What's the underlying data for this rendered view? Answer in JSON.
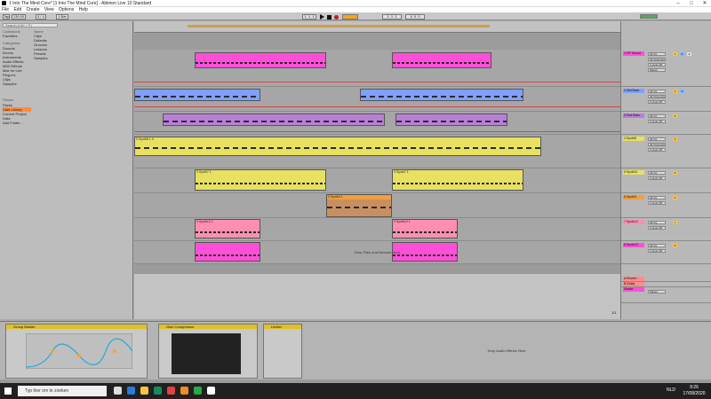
{
  "window": {
    "title": "1 Into The Mind Core* [1 Into The Mind Core] - Ableton Live 10 Standard"
  },
  "menu": [
    "File",
    "Edit",
    "Create",
    "View",
    "Options",
    "Help"
  ],
  "browser": {
    "search_placeholder": "Search (Ctrl + F)",
    "collections_label": "Collections",
    "collections": [
      "Favorites"
    ],
    "categories_label": "Categories",
    "categories": [
      "Sounds",
      "Drums",
      "Instruments",
      "Audio Effects",
      "MIDI Effects",
      "Max for Live",
      "Plug-ins",
      "Clips",
      "Samples"
    ],
    "places_label": "Places",
    "places": [
      "Packs",
      "User Library",
      "Current Project",
      "Data",
      "Add Folder..."
    ],
    "header": "Name",
    "files": [
      "Clips",
      "Defaults",
      "Grooves",
      "Lessons",
      "Presets",
      "Samples"
    ]
  },
  "arrangement": {
    "drop_text": "Drop Files and Devices Here",
    "page_indicator": "1/1"
  },
  "clips": {
    "synth_pattern": "0 Synth8 1 4",
    "synth6": "0 Synth6 1 4",
    "synth7": "0 Synth7 1",
    "synth12": "0 Synth12 1",
    "synth3": "0 Synth3 1"
  },
  "tracks": [
    {
      "name": "1 HP Sound",
      "color": "#ff4fd8",
      "num": "1"
    },
    {
      "name": "2 Mid Bass",
      "color": "#7fa0ff",
      "num": "2"
    },
    {
      "name": "3 Pad Bass",
      "color": "#b97fd6",
      "num": "3"
    },
    {
      "name": "4 Synth8",
      "color": "#e8e060",
      "num": "4"
    },
    {
      "name": "5 Synth11",
      "color": "#e8e060",
      "num": "5"
    },
    {
      "name": "6 Synth3",
      "color": "#f0a040",
      "num": "6"
    },
    {
      "name": "7 Synth12",
      "color": "#ff8fb0",
      "num": "7"
    },
    {
      "name": "8 Synth13",
      "color": "#ff4fd8",
      "num": "8"
    }
  ],
  "returns": [
    {
      "name": "A Reverb",
      "color": "#ff8c8c"
    },
    {
      "name": "B Delay",
      "color": "#ff8c8c"
    },
    {
      "name": "Master",
      "color": "#ff4fd8"
    }
  ],
  "mixer_labels": {
    "input": "All Ins",
    "channel": "All Channels",
    "monitor": "In Auto Off",
    "output": "Master"
  },
  "devices": {
    "eq": "Group Master",
    "comp": "Glue Compressor",
    "limiter": "Limiter",
    "drop_text": "Drop Audio Effects Here"
  },
  "taskbar": {
    "search_placeholder": "Typ hier om te zoeken",
    "time": "9:26",
    "date": "17/08/2020",
    "lang": "NLD"
  },
  "transport": {
    "tempo": "130.00",
    "sig": "4 / 4",
    "bar": "1 Bar",
    "pos": "1. 1. 1"
  }
}
